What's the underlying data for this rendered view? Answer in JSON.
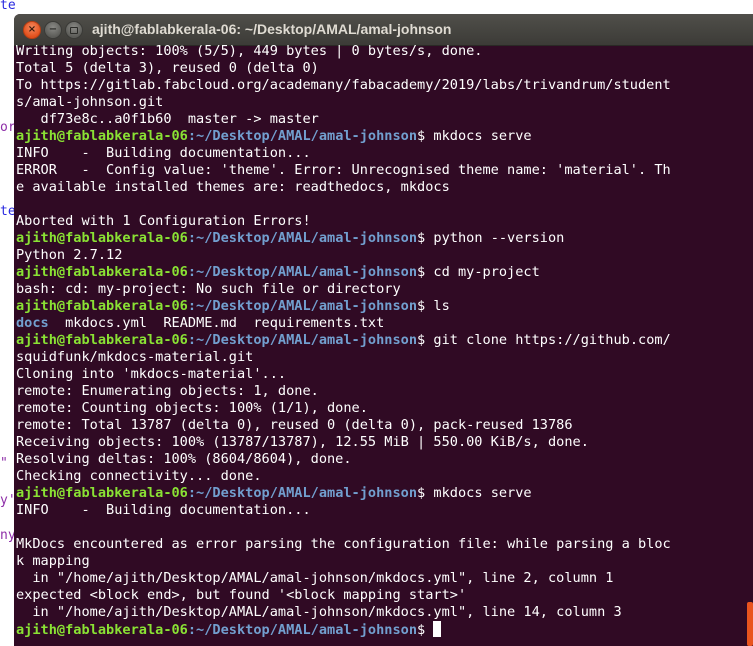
{
  "background_editor": {
    "fragments": [
      "te",
      "or",
      "te",
      "\"",
      "y'",
      "ny"
    ]
  },
  "window": {
    "title": "ajith@fablabkerala-06: ~/Desktop/AMAL/amal-johnson",
    "buttons": {
      "close": "×",
      "minimize": "−"
    }
  },
  "prompt": {
    "user_host": "ajith@fablabkerala-06",
    "path": ":~/Desktop/AMAL/amal-johnson",
    "symbol": "$"
  },
  "terminal": {
    "lines": [
      {
        "text": "Writing objects: 100% (5/5), 449 bytes | 0 bytes/s, done."
      },
      {
        "text": "Total 5 (delta 3), reused 0 (delta 0)"
      },
      {
        "text": "To https://gitlab.fabcloud.org/academany/fabacademy/2019/labs/trivandrum/student"
      },
      {
        "text": "s/amal-johnson.git"
      },
      {
        "text": "   df73e8c..a0f1b60  master -> master"
      },
      {
        "prompt": true,
        "cmd": " mkdocs serve"
      },
      {
        "text": "INFO    -  Building documentation..."
      },
      {
        "text": "ERROR   -  Config value: 'theme'. Error: Unrecognised theme name: 'material'. Th"
      },
      {
        "text": "e available installed themes are: readthedocs, mkdocs"
      },
      {
        "text": ""
      },
      {
        "text": "Aborted with 1 Configuration Errors!"
      },
      {
        "prompt": true,
        "cmd": " python --version"
      },
      {
        "text": "Python 2.7.12"
      },
      {
        "prompt": true,
        "cmd": " cd my-project"
      },
      {
        "text": "bash: cd: my-project: No such file or directory"
      },
      {
        "prompt": true,
        "cmd": " ls"
      },
      {
        "dir": "docs",
        "text": "  mkdocs.yml  README.md  requirements.txt"
      },
      {
        "prompt": true,
        "cmd": " git clone https://github.com/"
      },
      {
        "text": "squidfunk/mkdocs-material.git"
      },
      {
        "text": "Cloning into 'mkdocs-material'..."
      },
      {
        "text": "remote: Enumerating objects: 1, done."
      },
      {
        "text": "remote: Counting objects: 100% (1/1), done."
      },
      {
        "text": "remote: Total 13787 (delta 0), reused 0 (delta 0), pack-reused 13786"
      },
      {
        "text": "Receiving objects: 100% (13787/13787), 12.55 MiB | 550.00 KiB/s, done."
      },
      {
        "text": "Resolving deltas: 100% (8604/8604), done."
      },
      {
        "text": "Checking connectivity... done."
      },
      {
        "prompt": true,
        "cmd": " mkdocs serve"
      },
      {
        "text": "INFO    -  Building documentation..."
      },
      {
        "text": ""
      },
      {
        "text": "MkDocs encountered as error parsing the configuration file: while parsing a bloc"
      },
      {
        "text": "k mapping"
      },
      {
        "text": "  in \"/home/ajith/Desktop/AMAL/amal-johnson/mkdocs.yml\", line 2, column 1"
      },
      {
        "text": "expected <block end>, but found '<block mapping start>'"
      },
      {
        "text": "  in \"/home/ajith/Desktop/AMAL/amal-johnson/mkdocs.yml\", line 14, column 3"
      },
      {
        "prompt": true,
        "cmd": " ",
        "cursor": true
      }
    ]
  },
  "colors": {
    "terminal_bg": "#300a24",
    "prompt_user": "#8ae234",
    "prompt_path": "#729fcf",
    "scroll_thumb": "#e9541e"
  }
}
